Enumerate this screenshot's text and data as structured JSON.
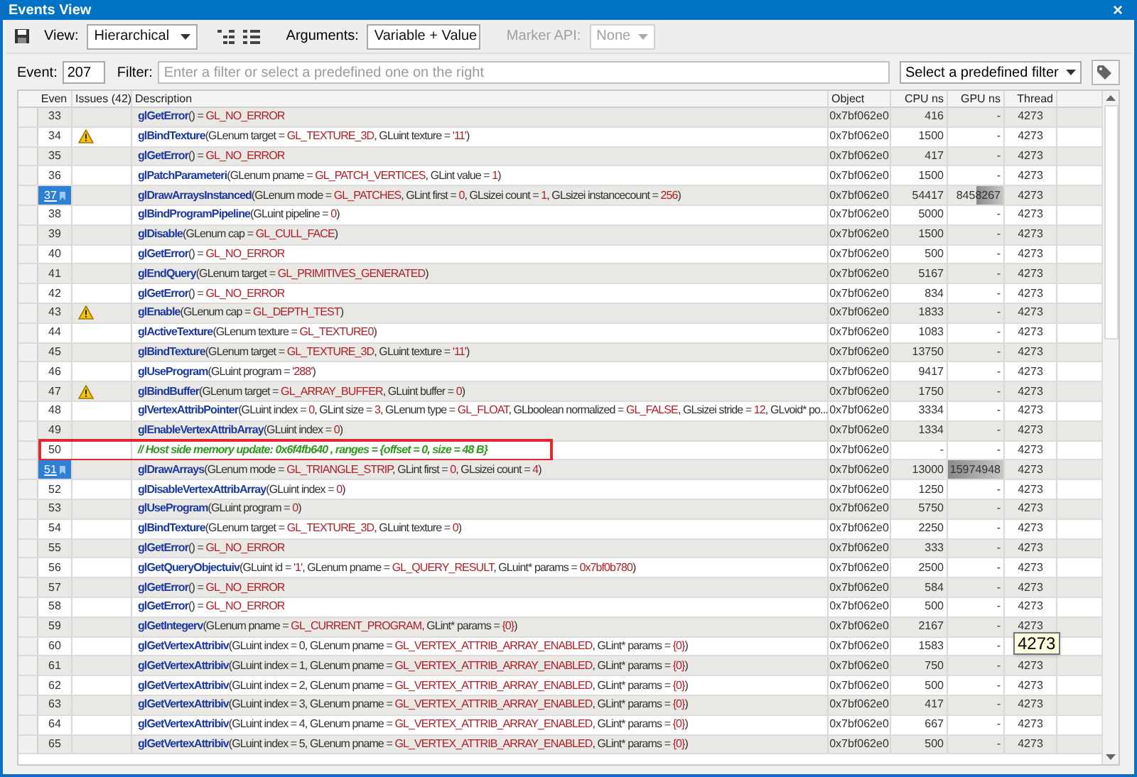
{
  "window": {
    "title": "Events View",
    "close": "×"
  },
  "toolbar": {
    "view_label": "View:",
    "view_value": "Hierarchical",
    "arguments_label": "Arguments:",
    "arguments_value": "Variable + Value",
    "marker_label": "Marker API:",
    "marker_value": "None",
    "marker_disabled": true
  },
  "filter_bar": {
    "event_label": "Event:",
    "event_value": "207",
    "filter_label": "Filter:",
    "filter_placeholder": "Enter a filter or select a predefined one on the right",
    "predefined": "Select a predefined filter"
  },
  "table": {
    "columns": [
      "Even",
      "Issues (42)",
      "Description",
      "Object",
      "CPU ns",
      "GPU ns",
      "Thread"
    ],
    "rows": [
      {
        "event": "33",
        "selected": false,
        "warning": false,
        "boxed": false,
        "parts": [
          {
            "kind": "fn",
            "text": "glGetError"
          },
          {
            "kind": "arg",
            "text": "() = "
          },
          {
            "kind": "val",
            "text": "GL_NO_ERROR"
          }
        ],
        "object": "0x7bf062e0",
        "cpu": "416",
        "gpu": "-",
        "thread": "4273"
      },
      {
        "event": "34",
        "selected": false,
        "warning": true,
        "boxed": false,
        "parts": [
          {
            "kind": "fn",
            "text": "glBindTexture"
          },
          {
            "kind": "arg",
            "text": "(GLenum target = "
          },
          {
            "kind": "val",
            "text": "GL_TEXTURE_3D"
          },
          {
            "kind": "arg",
            "text": ", GLuint texture = "
          },
          {
            "kind": "val",
            "text": "'11'"
          },
          {
            "kind": "arg",
            "text": ")"
          }
        ],
        "object": "0x7bf062e0",
        "cpu": "1500",
        "gpu": "-",
        "thread": "4273"
      },
      {
        "event": "35",
        "selected": false,
        "warning": false,
        "boxed": false,
        "parts": [
          {
            "kind": "fn",
            "text": "glGetError"
          },
          {
            "kind": "arg",
            "text": "() = "
          },
          {
            "kind": "val",
            "text": "GL_NO_ERROR"
          }
        ],
        "object": "0x7bf062e0",
        "cpu": "417",
        "gpu": "-",
        "thread": "4273"
      },
      {
        "event": "36",
        "selected": false,
        "warning": false,
        "boxed": false,
        "parts": [
          {
            "kind": "fn",
            "text": "glPatchParameteri"
          },
          {
            "kind": "arg",
            "text": "(GLenum pname = "
          },
          {
            "kind": "val",
            "text": "GL_PATCH_VERTICES"
          },
          {
            "kind": "arg",
            "text": ", GLint value = "
          },
          {
            "kind": "val",
            "text": "1"
          },
          {
            "kind": "arg",
            "text": ")"
          }
        ],
        "object": "0x7bf062e0",
        "cpu": "1500",
        "gpu": "-",
        "thread": "4273"
      },
      {
        "event": "37",
        "selected": true,
        "warning": false,
        "boxed": false,
        "parts": [
          {
            "kind": "fn",
            "text": "glDrawArraysInstanced"
          },
          {
            "kind": "arg",
            "text": "(GLenum mode = "
          },
          {
            "kind": "val",
            "text": "GL_PATCHES"
          },
          {
            "kind": "arg",
            "text": ", GLint first = "
          },
          {
            "kind": "val",
            "text": "0"
          },
          {
            "kind": "arg",
            "text": ", GLsizei count = "
          },
          {
            "kind": "val",
            "text": "1"
          },
          {
            "kind": "arg",
            "text": ", GLsizei instancecount = "
          },
          {
            "kind": "val",
            "text": "256"
          },
          {
            "kind": "arg",
            "text": ")"
          }
        ],
        "object": "0x7bf062e0",
        "cpu": "54417",
        "gpu": "8458267",
        "level": 0.5,
        "thread": "4273"
      },
      {
        "event": "38",
        "selected": false,
        "warning": false,
        "boxed": false,
        "parts": [
          {
            "kind": "fn",
            "text": "glBindProgramPipeline"
          },
          {
            "kind": "arg",
            "text": "(GLuint pipeline = "
          },
          {
            "kind": "val",
            "text": "0"
          },
          {
            "kind": "arg",
            "text": ")"
          }
        ],
        "object": "0x7bf062e0",
        "cpu": "5000",
        "gpu": "-",
        "thread": "4273"
      },
      {
        "event": "39",
        "selected": false,
        "warning": false,
        "boxed": false,
        "parts": [
          {
            "kind": "fn",
            "text": "glDisable"
          },
          {
            "kind": "arg",
            "text": "(GLenum cap = "
          },
          {
            "kind": "val",
            "text": "GL_CULL_FACE"
          },
          {
            "kind": "arg",
            "text": ")"
          }
        ],
        "object": "0x7bf062e0",
        "cpu": "1500",
        "gpu": "-",
        "thread": "4273"
      },
      {
        "event": "40",
        "selected": false,
        "warning": false,
        "boxed": false,
        "parts": [
          {
            "kind": "fn",
            "text": "glGetError"
          },
          {
            "kind": "arg",
            "text": "() = "
          },
          {
            "kind": "val",
            "text": "GL_NO_ERROR"
          }
        ],
        "object": "0x7bf062e0",
        "cpu": "500",
        "gpu": "-",
        "thread": "4273"
      },
      {
        "event": "41",
        "selected": false,
        "warning": false,
        "boxed": false,
        "parts": [
          {
            "kind": "fn",
            "text": "glEndQuery"
          },
          {
            "kind": "arg",
            "text": "(GLenum target = "
          },
          {
            "kind": "val",
            "text": "GL_PRIMITIVES_GENERATED"
          },
          {
            "kind": "arg",
            "text": ")"
          }
        ],
        "object": "0x7bf062e0",
        "cpu": "5167",
        "gpu": "-",
        "thread": "4273"
      },
      {
        "event": "42",
        "selected": false,
        "warning": false,
        "boxed": false,
        "parts": [
          {
            "kind": "fn",
            "text": "glGetError"
          },
          {
            "kind": "arg",
            "text": "() = "
          },
          {
            "kind": "val",
            "text": "GL_NO_ERROR"
          }
        ],
        "object": "0x7bf062e0",
        "cpu": "834",
        "gpu": "-",
        "thread": "4273"
      },
      {
        "event": "43",
        "selected": false,
        "warning": true,
        "boxed": false,
        "parts": [
          {
            "kind": "fn",
            "text": "glEnable"
          },
          {
            "kind": "arg",
            "text": "(GLenum cap = "
          },
          {
            "kind": "val",
            "text": "GL_DEPTH_TEST"
          },
          {
            "kind": "arg",
            "text": ")"
          }
        ],
        "object": "0x7bf062e0",
        "cpu": "1833",
        "gpu": "-",
        "thread": "4273"
      },
      {
        "event": "44",
        "selected": false,
        "warning": false,
        "boxed": false,
        "parts": [
          {
            "kind": "fn",
            "text": "glActiveTexture"
          },
          {
            "kind": "arg",
            "text": "(GLenum texture = "
          },
          {
            "kind": "val",
            "text": "GL_TEXTURE0"
          },
          {
            "kind": "arg",
            "text": ")"
          }
        ],
        "object": "0x7bf062e0",
        "cpu": "1083",
        "gpu": "-",
        "thread": "4273"
      },
      {
        "event": "45",
        "selected": false,
        "warning": false,
        "boxed": false,
        "parts": [
          {
            "kind": "fn",
            "text": "glBindTexture"
          },
          {
            "kind": "arg",
            "text": "(GLenum target = "
          },
          {
            "kind": "val",
            "text": "GL_TEXTURE_3D"
          },
          {
            "kind": "arg",
            "text": ", GLuint texture = "
          },
          {
            "kind": "val",
            "text": "'11'"
          },
          {
            "kind": "arg",
            "text": ")"
          }
        ],
        "object": "0x7bf062e0",
        "cpu": "13750",
        "gpu": "-",
        "thread": "4273"
      },
      {
        "event": "46",
        "selected": false,
        "warning": false,
        "boxed": false,
        "parts": [
          {
            "kind": "fn",
            "text": "glUseProgram"
          },
          {
            "kind": "arg",
            "text": "(GLuint program = "
          },
          {
            "kind": "val",
            "text": "'288'"
          },
          {
            "kind": "arg",
            "text": ")"
          }
        ],
        "object": "0x7bf062e0",
        "cpu": "9417",
        "gpu": "-",
        "thread": "4273"
      },
      {
        "event": "47",
        "selected": false,
        "warning": true,
        "boxed": false,
        "parts": [
          {
            "kind": "fn",
            "text": "glBindBuffer"
          },
          {
            "kind": "arg",
            "text": "(GLenum target = "
          },
          {
            "kind": "val",
            "text": "GL_ARRAY_BUFFER"
          },
          {
            "kind": "arg",
            "text": ", GLuint buffer = "
          },
          {
            "kind": "val",
            "text": "0"
          },
          {
            "kind": "arg",
            "text": ")"
          }
        ],
        "object": "0x7bf062e0",
        "cpu": "1750",
        "gpu": "-",
        "thread": "4273"
      },
      {
        "event": "48",
        "selected": false,
        "warning": false,
        "boxed": false,
        "parts": [
          {
            "kind": "fn",
            "text": "glVertexAttribPointer"
          },
          {
            "kind": "arg",
            "text": "(GLuint index = "
          },
          {
            "kind": "val",
            "text": "0"
          },
          {
            "kind": "arg",
            "text": ", GLint size = "
          },
          {
            "kind": "val",
            "text": "3"
          },
          {
            "kind": "arg",
            "text": ", GLenum type = "
          },
          {
            "kind": "val",
            "text": "GL_FLOAT"
          },
          {
            "kind": "arg",
            "text": ", GLboolean normalized = "
          },
          {
            "kind": "val",
            "text": "GL_FALSE"
          },
          {
            "kind": "arg",
            "text": ", GLsizei stride = "
          },
          {
            "kind": "val",
            "text": "12"
          },
          {
            "kind": "arg",
            "text": ", GLvoid* po..."
          }
        ],
        "object": "0x7bf062e0",
        "cpu": "3334",
        "gpu": "-",
        "thread": "4273"
      },
      {
        "event": "49",
        "selected": false,
        "warning": false,
        "boxed": false,
        "parts": [
          {
            "kind": "fn",
            "text": "glEnableVertexAttribArray"
          },
          {
            "kind": "arg",
            "text": "(GLuint index = "
          },
          {
            "kind": "val",
            "text": "0"
          },
          {
            "kind": "arg",
            "text": ")"
          }
        ],
        "object": "0x7bf062e0",
        "cpu": "1334",
        "gpu": "-",
        "thread": "4273"
      },
      {
        "event": "50",
        "selected": false,
        "warning": false,
        "boxed": true,
        "parts": [
          {
            "kind": "comment",
            "text": "// Host side memory update: 0x6f4fb640 , ranges = {offset = 0, size = 48 B}"
          }
        ],
        "object": "0x7bf062e0",
        "cpu": "-",
        "gpu": "-",
        "thread": "4273"
      },
      {
        "event": "51",
        "selected": true,
        "warning": false,
        "boxed": false,
        "parts": [
          {
            "kind": "fn",
            "text": "glDrawArrays"
          },
          {
            "kind": "arg",
            "text": "(GLenum mode = "
          },
          {
            "kind": "val",
            "text": "GL_TRIANGLE_STRIP"
          },
          {
            "kind": "arg",
            "text": ", GLint first = "
          },
          {
            "kind": "val",
            "text": "0"
          },
          {
            "kind": "arg",
            "text": ", GLsizei count = "
          },
          {
            "kind": "val",
            "text": "4"
          },
          {
            "kind": "arg",
            "text": ")"
          }
        ],
        "object": "0x7bf062e0",
        "cpu": "13000",
        "gpu": "15974948",
        "level": 1,
        "thread": "4273"
      },
      {
        "event": "52",
        "selected": false,
        "warning": false,
        "boxed": false,
        "parts": [
          {
            "kind": "fn",
            "text": "glDisableVertexAttribArray"
          },
          {
            "kind": "arg",
            "text": "(GLuint index = "
          },
          {
            "kind": "val",
            "text": "0"
          },
          {
            "kind": "arg",
            "text": ")"
          }
        ],
        "object": "0x7bf062e0",
        "cpu": "1250",
        "gpu": "-",
        "thread": "4273"
      },
      {
        "event": "53",
        "selected": false,
        "warning": false,
        "boxed": false,
        "parts": [
          {
            "kind": "fn",
            "text": "glUseProgram"
          },
          {
            "kind": "arg",
            "text": "(GLuint program = "
          },
          {
            "kind": "val",
            "text": "0"
          },
          {
            "kind": "arg",
            "text": ")"
          }
        ],
        "object": "0x7bf062e0",
        "cpu": "5750",
        "gpu": "-",
        "thread": "4273"
      },
      {
        "event": "54",
        "selected": false,
        "warning": false,
        "boxed": false,
        "parts": [
          {
            "kind": "fn",
            "text": "glBindTexture"
          },
          {
            "kind": "arg",
            "text": "(GLenum target = "
          },
          {
            "kind": "val",
            "text": "GL_TEXTURE_3D"
          },
          {
            "kind": "arg",
            "text": ", GLuint texture = "
          },
          {
            "kind": "val",
            "text": "0"
          },
          {
            "kind": "arg",
            "text": ")"
          }
        ],
        "object": "0x7bf062e0",
        "cpu": "2250",
        "gpu": "-",
        "thread": "4273"
      },
      {
        "event": "55",
        "selected": false,
        "warning": false,
        "boxed": false,
        "parts": [
          {
            "kind": "fn",
            "text": "glGetError"
          },
          {
            "kind": "arg",
            "text": "() = "
          },
          {
            "kind": "val",
            "text": "GL_NO_ERROR"
          }
        ],
        "object": "0x7bf062e0",
        "cpu": "333",
        "gpu": "-",
        "thread": "4273"
      },
      {
        "event": "56",
        "selected": false,
        "warning": false,
        "boxed": false,
        "parts": [
          {
            "kind": "fn",
            "text": "glGetQueryObjectuiv"
          },
          {
            "kind": "arg",
            "text": "(GLuint id = "
          },
          {
            "kind": "val",
            "text": "'1'"
          },
          {
            "kind": "arg",
            "text": ", GLenum pname = "
          },
          {
            "kind": "val",
            "text": "GL_QUERY_RESULT"
          },
          {
            "kind": "arg",
            "text": ", GLuint* params = "
          },
          {
            "kind": "val",
            "text": "0x7bf0b780"
          },
          {
            "kind": "arg",
            "text": ")"
          }
        ],
        "object": "0x7bf062e0",
        "cpu": "2500",
        "gpu": "-",
        "thread": "4273"
      },
      {
        "event": "57",
        "selected": false,
        "warning": false,
        "boxed": false,
        "parts": [
          {
            "kind": "fn",
            "text": "glGetError"
          },
          {
            "kind": "arg",
            "text": "() = "
          },
          {
            "kind": "val",
            "text": "GL_NO_ERROR"
          }
        ],
        "object": "0x7bf062e0",
        "cpu": "584",
        "gpu": "-",
        "thread": "4273"
      },
      {
        "event": "58",
        "selected": false,
        "warning": false,
        "boxed": false,
        "parts": [
          {
            "kind": "fn",
            "text": "glGetError"
          },
          {
            "kind": "arg",
            "text": "() = "
          },
          {
            "kind": "val",
            "text": "GL_NO_ERROR"
          }
        ],
        "object": "0x7bf062e0",
        "cpu": "500",
        "gpu": "-",
        "thread": "4273"
      },
      {
        "event": "59",
        "selected": false,
        "warning": false,
        "boxed": false,
        "parts": [
          {
            "kind": "fn",
            "text": "glGetIntegerv"
          },
          {
            "kind": "arg",
            "text": "(GLenum pname = "
          },
          {
            "kind": "val",
            "text": "GL_CURRENT_PROGRAM"
          },
          {
            "kind": "arg",
            "text": ", GLint* params = "
          },
          {
            "kind": "val",
            "text": "{0}"
          },
          {
            "kind": "arg",
            "text": ")"
          }
        ],
        "object": "0x7bf062e0",
        "cpu": "2167",
        "gpu": "-",
        "thread": "4273"
      },
      {
        "event": "60",
        "selected": false,
        "warning": false,
        "boxed": false,
        "parts": [
          {
            "kind": "fn",
            "text": "glGetVertexAttribiv"
          },
          {
            "kind": "arg",
            "text": "(GLuint index = 0, GLenum pname = "
          },
          {
            "kind": "val",
            "text": "GL_VERTEX_ATTRIB_ARRAY_ENABLED"
          },
          {
            "kind": "arg",
            "text": ", GLint* params = "
          },
          {
            "kind": "val",
            "text": "{0}"
          },
          {
            "kind": "arg",
            "text": ")"
          }
        ],
        "object": "0x7bf062e0",
        "cpu": "1583",
        "gpu": "-"
      },
      {
        "event": "61",
        "selected": false,
        "warning": false,
        "boxed": false,
        "parts": [
          {
            "kind": "fn",
            "text": "glGetVertexAttribiv"
          },
          {
            "kind": "arg",
            "text": "(GLuint index = 1, GLenum pname = "
          },
          {
            "kind": "val",
            "text": "GL_VERTEX_ATTRIB_ARRAY_ENABLED"
          },
          {
            "kind": "arg",
            "text": ", GLint* params = "
          },
          {
            "kind": "val",
            "text": "{0}"
          },
          {
            "kind": "arg",
            "text": ")"
          }
        ],
        "object": "0x7bf062e0",
        "cpu": "750",
        "gpu": "-",
        "thread": "4273"
      },
      {
        "event": "62",
        "selected": false,
        "warning": false,
        "boxed": false,
        "parts": [
          {
            "kind": "fn",
            "text": "glGetVertexAttribiv"
          },
          {
            "kind": "arg",
            "text": "(GLuint index = 2, GLenum pname = "
          },
          {
            "kind": "val",
            "text": "GL_VERTEX_ATTRIB_ARRAY_ENABLED"
          },
          {
            "kind": "arg",
            "text": ", GLint* params = "
          },
          {
            "kind": "val",
            "text": "{0}"
          },
          {
            "kind": "arg",
            "text": ")"
          }
        ],
        "object": "0x7bf062e0",
        "cpu": "500",
        "gpu": "-",
        "thread": "4273"
      },
      {
        "event": "63",
        "selected": false,
        "warning": false,
        "boxed": false,
        "parts": [
          {
            "kind": "fn",
            "text": "glGetVertexAttribiv"
          },
          {
            "kind": "arg",
            "text": "(GLuint index = 3, GLenum pname = "
          },
          {
            "kind": "val",
            "text": "GL_VERTEX_ATTRIB_ARRAY_ENABLED"
          },
          {
            "kind": "arg",
            "text": ", GLint* params = "
          },
          {
            "kind": "val",
            "text": "{0}"
          },
          {
            "kind": "arg",
            "text": ")"
          }
        ],
        "object": "0x7bf062e0",
        "cpu": "417",
        "gpu": "-",
        "thread": "4273"
      },
      {
        "event": "64",
        "selected": false,
        "warning": false,
        "boxed": false,
        "parts": [
          {
            "kind": "fn",
            "text": "glGetVertexAttribiv"
          },
          {
            "kind": "arg",
            "text": "(GLuint index = 4, GLenum pname = "
          },
          {
            "kind": "val",
            "text": "GL_VERTEX_ATTRIB_ARRAY_ENABLED"
          },
          {
            "kind": "arg",
            "text": ", GLint* params = "
          },
          {
            "kind": "val",
            "text": "{0}"
          },
          {
            "kind": "arg",
            "text": ")"
          }
        ],
        "object": "0x7bf062e0",
        "cpu": "667",
        "gpu": "-",
        "thread": "4273"
      },
      {
        "event": "65",
        "selected": false,
        "warning": false,
        "boxed": false,
        "parts": [
          {
            "kind": "fn",
            "text": "glGetVertexAttribiv"
          },
          {
            "kind": "arg",
            "text": "(GLuint index = 5, GLenum pname = "
          },
          {
            "kind": "val",
            "text": "GL_VERTEX_ATTRIB_ARRAY_ENABLED"
          },
          {
            "kind": "arg",
            "text": ", GLint* params = "
          },
          {
            "kind": "val",
            "text": "{0}"
          },
          {
            "kind": "arg",
            "text": ")"
          }
        ],
        "object": "0x7bf062e0",
        "cpu": "500",
        "gpu": "-",
        "thread": "4273"
      }
    ]
  },
  "tooltip": {
    "text": "4273"
  }
}
